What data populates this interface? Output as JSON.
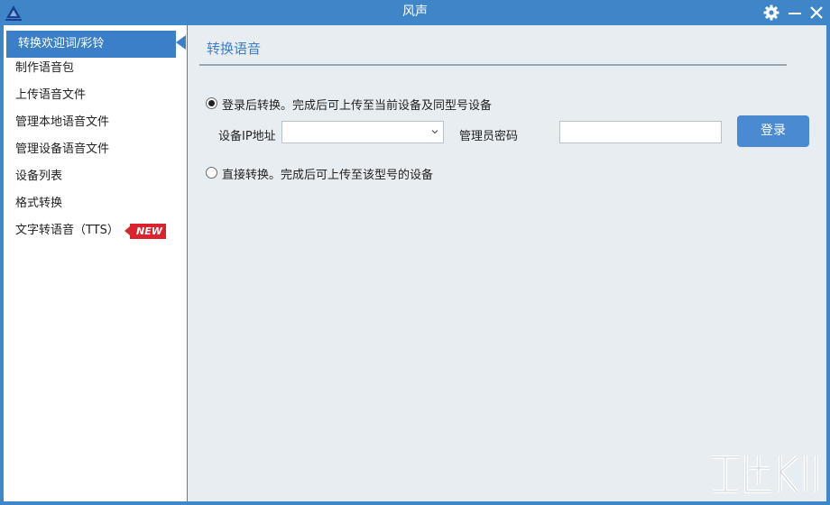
{
  "window": {
    "title": "风声",
    "accent": "#3f86c9",
    "controls": [
      "gear-icon",
      "minimize-icon",
      "close-icon"
    ]
  },
  "sidebar": {
    "items": [
      {
        "label": "转换欢迎词/彩铃",
        "active": true
      },
      {
        "label": "制作语音包"
      },
      {
        "label": "上传语音文件"
      },
      {
        "label": "管理本地语音文件"
      },
      {
        "label": "管理设备语音文件"
      },
      {
        "label": "设备列表"
      },
      {
        "label": "格式转换"
      },
      {
        "label": "文字转语音（TTS）",
        "badge": "NEW"
      }
    ],
    "badge_color": "#d9232f"
  },
  "main": {
    "section_title": "转换语音",
    "option_login": {
      "label": "登录后转换。完成后可上传至当前设备及同型号设备",
      "checked": true
    },
    "ip_label": "设备IP地址",
    "ip_value": "",
    "password_label": "管理员密码",
    "password_value": "",
    "login_button": "登录",
    "option_direct": {
      "label": "直接转换。完成后可上传至该型号的设备",
      "checked": false
    }
  }
}
